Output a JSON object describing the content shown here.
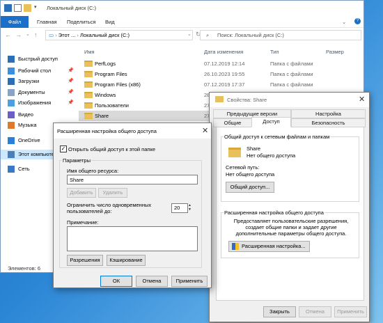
{
  "explorer": {
    "title": "Локальный диск (C:)",
    "ribbon_tabs": [
      "Файл",
      "Главная",
      "Поделиться",
      "Вид"
    ],
    "path": [
      "Этот ...",
      "Локальный диск (C:)"
    ],
    "search_placeholder": "Поиск: Локальный диск (C:)",
    "columns": {
      "name": "Имя",
      "date": "Дата изменения",
      "type": "Тип",
      "size": "Размер"
    },
    "files": [
      {
        "name": "PerfLogs",
        "date": "07.12.2019 12:14",
        "type": "Папка с файлами"
      },
      {
        "name": "Program Files",
        "date": "26.10.2023 19:55",
        "type": "Папка с файлами"
      },
      {
        "name": "Program Files (x86)",
        "date": "07.12.2019 17:37",
        "type": "Папка с файлами"
      },
      {
        "name": "Windows",
        "date": "28",
        "type": ""
      },
      {
        "name": "Пользователи",
        "date": "27",
        "type": ""
      },
      {
        "name": "Share",
        "date": "27",
        "type": ""
      }
    ],
    "sidebar": [
      {
        "label": "Быстрый доступ",
        "icon": "star-icon",
        "pinned": false
      },
      {
        "label": "Рабочий стол",
        "icon": "desktop-icon",
        "pinned": true
      },
      {
        "label": "Загрузки",
        "icon": "download-icon",
        "pinned": true
      },
      {
        "label": "Документы",
        "icon": "document-icon",
        "pinned": true
      },
      {
        "label": "Изображения",
        "icon": "image-icon",
        "pinned": true
      },
      {
        "label": "Видео",
        "icon": "video-icon",
        "pinned": false
      },
      {
        "label": "Музыка",
        "icon": "music-icon",
        "pinned": false
      },
      {
        "label": "OneDrive",
        "icon": "cloud-icon",
        "pinned": false
      },
      {
        "label": "Этот компьютер",
        "icon": "computer-icon",
        "pinned": false
      },
      {
        "label": "Сеть",
        "icon": "network-icon",
        "pinned": false
      }
    ],
    "status": "Элементов: 6"
  },
  "props": {
    "title": "Свойства: Share",
    "tabs_row1": [
      "Предыдущие версии",
      "Настройка"
    ],
    "tabs_row2": [
      "Общие",
      "Доступ",
      "Безопасность"
    ],
    "group1_title": "Общий доступ к сетевым файлам и папкам",
    "share_name": "Share",
    "share_status": "Нет общего доступа",
    "net_path_label": "Сетевой путь:",
    "net_path_value": "Нет общего доступа",
    "share_button": "Общий доступ...",
    "group2_title": "Расширенная настройка общего доступа",
    "group2_desc": "Предоставляет пользовательские разрешения, создает общие папки и задает другие дополнительные параметры общего доступа.",
    "advanced_button": "Расширенная настройка...",
    "close_button": "Закрыть",
    "cancel_button": "Отмена",
    "apply_button": "Применить"
  },
  "adv": {
    "title": "Расширенная настройка общего доступа",
    "checkbox_label": "Открыть общий доступ к этой папке",
    "params_label": "Параметры",
    "share_name_label": "Имя общего ресурса:",
    "share_name_value": "Share",
    "add_button": "Добавить",
    "remove_button": "Удалить",
    "limit_label": "Ограничить число одновременных пользователей до:",
    "limit_value": "20",
    "note_label": "Примечание:",
    "permissions_button": "Разрешения",
    "caching_button": "Кэширование",
    "ok_button": "ОК",
    "cancel_button": "Отмена",
    "apply_button": "Применить"
  },
  "colors": {
    "accent": "#1a6fc9",
    "folder": "#e9c15a",
    "selection": "#cce8ff"
  }
}
